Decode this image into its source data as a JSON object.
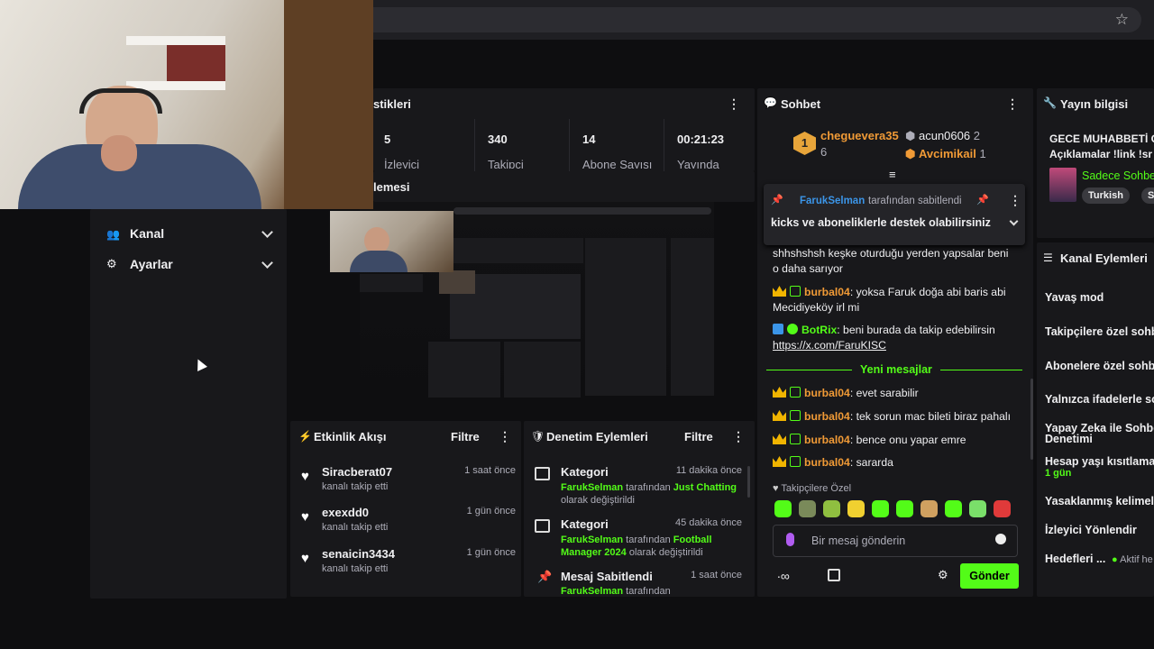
{
  "browser": {
    "url_text": ""
  },
  "stats_panel": {
    "title": "stikleri",
    "stats": [
      {
        "value": "5",
        "label": "İzleyici"
      },
      {
        "value": "340",
        "label": "Takipçi"
      },
      {
        "value": "14",
        "label": "Abone Sayısı"
      },
      {
        "value": "00:21:23",
        "label": "Yayında"
      }
    ]
  },
  "preview": {
    "title": "lemesi"
  },
  "sidebar": {
    "items": [
      {
        "label": "Kanal",
        "icon": "users-icon"
      },
      {
        "label": "Ayarlar",
        "icon": "gear-icon"
      }
    ]
  },
  "activity": {
    "title": "Etkinlik Akışı",
    "filter": "Filtre",
    "items": [
      {
        "name": "Siracberat07",
        "sub": "kanalı takip etti",
        "time": "1 saat önce"
      },
      {
        "name": "exexdd0",
        "sub": "kanalı takip etti",
        "time": "1 gün önce"
      },
      {
        "name": "senaicin3434",
        "sub": "kanalı takip etti",
        "time": "1 gün önce"
      }
    ]
  },
  "moderation": {
    "title": "Denetim Eylemleri",
    "filter": "Filtre",
    "items": [
      {
        "title": "Kategori",
        "time": "11 dakika önce",
        "user": "FarukSelman",
        "mid": " tarafından ",
        "target": "Just Chatting",
        "end": "olarak değiştirildi"
      },
      {
        "title": "Kategori",
        "time": "45 dakika önce",
        "user": "FarukSelman",
        "mid": " tarafından ",
        "target": "Football Manager 2024",
        "end": " olarak değiştirildi"
      },
      {
        "title": "Mesaj Sabitlendi",
        "time": "1 saat önce",
        "user": "FarukSelman",
        "mid": " tarafından",
        "target": "",
        "end": ""
      }
    ]
  },
  "chat": {
    "title": "Sohbet",
    "top_gifter": {
      "rank": "1",
      "name": "cheguevera35",
      "count": "6"
    },
    "gifters": [
      {
        "name": "acun0606",
        "count": "2"
      },
      {
        "name": "Avcimikail",
        "count": "1"
      }
    ],
    "pinned": {
      "user": "FarukSelman",
      "by": "tarafından sabitlendi",
      "text": "kicks ve aboneliklerle destek olabilirsiniz"
    },
    "messages": [
      {
        "user": "",
        "text": "shhshshsh keşke oturduğu yerden yapsalar beni o daha sarıyor"
      },
      {
        "user": "burbal04",
        "text": ": yoksa Faruk doğa abi baris abi Mecidiyeköy irl mi"
      },
      {
        "user": "BotRix",
        "text": ": beni burada da takip edebilirsin",
        "link": "https://x.com/FaruKISC"
      }
    ],
    "new_divider": "Yeni mesajlar",
    "new_messages": [
      {
        "user": "burbal04",
        "text": ": evet sarabilir"
      },
      {
        "user": "burbal04",
        "text": ": tek sorun mac bileti biraz pahalı"
      },
      {
        "user": "burbal04",
        "text": ": bence onu yapar emre"
      },
      {
        "user": "burbal04",
        "text": ": sararda"
      }
    ],
    "followers_only": "Takipçilere Özel",
    "input_placeholder": "Bir mesaj gönderin",
    "send": "Gönder"
  },
  "stream_info": {
    "title": "Yayın bilgisi",
    "stream_title": "GECE MUHABBETİ G",
    "stream_sub": "Açıklamalar !link !sr",
    "category": "Sadece Sohbe",
    "tags": [
      "Turkish",
      "Soh"
    ]
  },
  "channel_actions": {
    "title": "Kanal Eylemleri",
    "items": [
      "Yavaş mod",
      "Takipçilere özel sohb",
      "Abonelere özel sohbe",
      "Yalnızca ifadelerle so",
      "Yapay Zeka ile Sohbe",
      "Hesap yaşı kısıtlamas",
      "Yasaklanmış kelimele",
      "İzleyici Yönlendir",
      "Hedefleri ..."
    ],
    "ai_sub": "Denetimi",
    "age_sub": "1 gün",
    "goals_status": "Aktif he"
  }
}
